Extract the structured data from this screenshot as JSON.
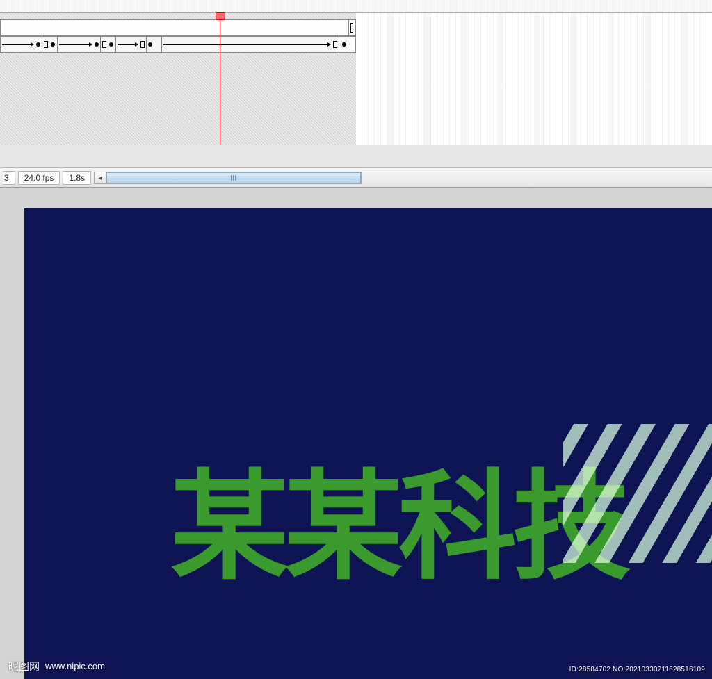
{
  "timeline": {
    "fps_label": "24.0 fps",
    "time_label": "1.8s",
    "frame_cell_partial": "3"
  },
  "stage": {
    "text": "某某科技",
    "bg_color": "#0e1453",
    "text_color": "#3a9a2d"
  },
  "watermark": {
    "site_name": "昵图网",
    "site_url": "www.nipic.com",
    "id_line": "ID:28584702 NO:20210330211628516109"
  }
}
